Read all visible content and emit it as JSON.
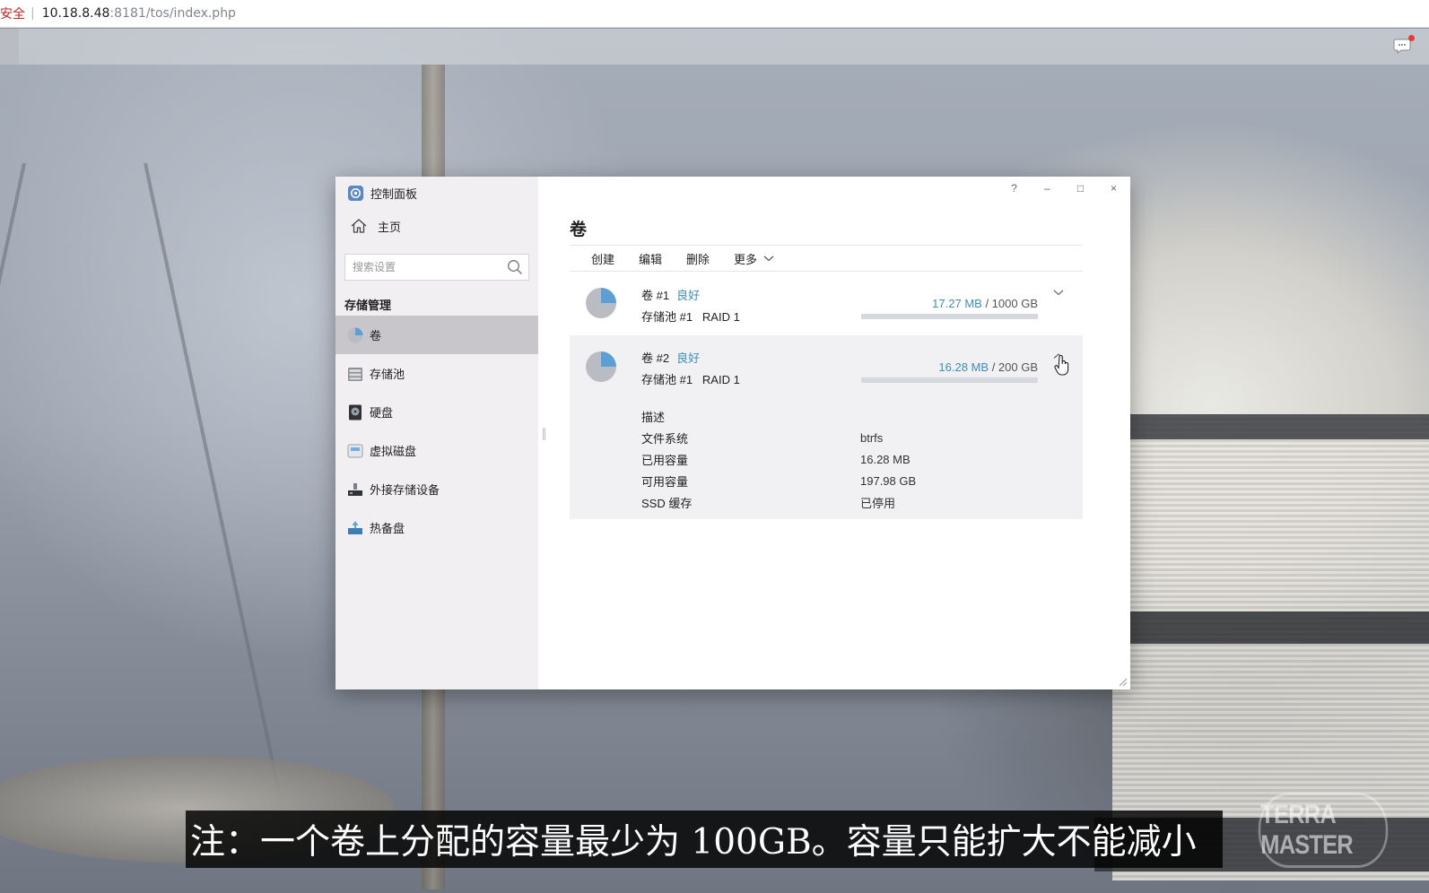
{
  "browser": {
    "security_label": "安全",
    "url_host": "10.18.8.48",
    "url_rest": ":8181/tos/index.php"
  },
  "window": {
    "app_title": "控制面板",
    "controls": [
      "?",
      "–",
      "□",
      "×"
    ]
  },
  "sidebar": {
    "home_label": "主页",
    "search_placeholder": "搜索设置",
    "section_title": "存储管理",
    "items": [
      {
        "label": "卷",
        "icon": "pie-icon",
        "active": true
      },
      {
        "label": "存储池",
        "icon": "storage-pool-icon"
      },
      {
        "label": "硬盘",
        "icon": "hard-disk-icon"
      },
      {
        "label": "虚拟磁盘",
        "icon": "virtual-disk-icon"
      },
      {
        "label": "外接存储设备",
        "icon": "external-storage-icon"
      },
      {
        "label": "热备盘",
        "icon": "hot-spare-icon"
      }
    ]
  },
  "main": {
    "title": "卷",
    "toolbar": {
      "create": "创建",
      "edit": "编辑",
      "delete": "删除",
      "more": "更多"
    },
    "volumes": [
      {
        "name": "卷 #1",
        "status": "良好",
        "pool": "存储池 #1",
        "raid": "RAID 1",
        "used": "17.27 MB",
        "total": "/ 1000 GB",
        "used_fraction": 0.0
      },
      {
        "name": "卷 #2",
        "status": "良好",
        "pool": "存储池 #1",
        "raid": "RAID 1",
        "used": "16.28 MB",
        "total": "/ 200 GB",
        "used_fraction": 0.0,
        "details": [
          {
            "key": "描述",
            "value": ""
          },
          {
            "key": "文件系统",
            "value": "btrfs"
          },
          {
            "key": "已用容量",
            "value": "16.28 MB"
          },
          {
            "key": "可用容量",
            "value": "197.98 GB"
          },
          {
            "key": "SSD 缓存",
            "value": "已停用"
          }
        ]
      }
    ]
  },
  "subtitle": "注：一个卷上分配的容量最少为 100GB。容量只能扩大不能减小",
  "watermark": "TERRA MASTER",
  "colors": {
    "accent": "#3c8ebc",
    "sidebar_bg": "#f1eff2",
    "active_item": "#c9c6cb",
    "bar_track": "#d5d8df"
  }
}
